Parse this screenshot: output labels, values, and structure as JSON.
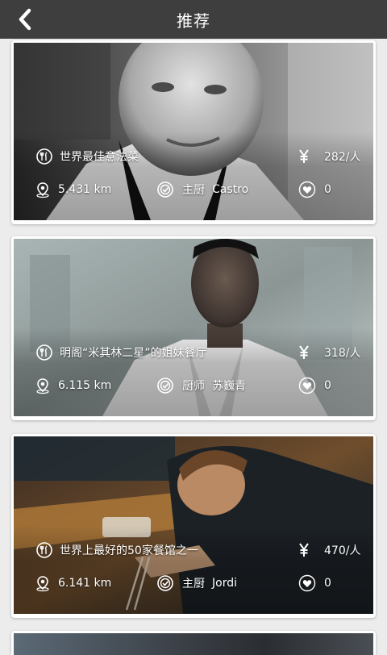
{
  "header": {
    "title": "推荐"
  },
  "restaurants": [
    {
      "description": "世界最佳意法菜",
      "price": "282/人",
      "distance": "5.431 km",
      "chef_title": "主厨",
      "chef_name": "Castro",
      "likes": "0"
    },
    {
      "description": "明阁“米其林二星”的姐妹餐厅",
      "price": "318/人",
      "distance": "6.115 km",
      "chef_title": "厨师",
      "chef_name": "苏巍青",
      "likes": "0"
    },
    {
      "description": "世界上最好的50家餐馆之一",
      "price": "470/人",
      "distance": "6.141 km",
      "chef_title": "主厨",
      "chef_name": "Jordi",
      "likes": "0"
    }
  ],
  "icons": {
    "back": "chevron-left-icon",
    "dish": "fork-knife-icon",
    "price": "yen-icon",
    "location": "map-pin-icon",
    "chef": "chef-badge-icon",
    "like": "heart-icon"
  },
  "colors": {
    "header_bg": "#3e3e3e",
    "page_bg": "#ececec",
    "text_on_photo": "#ffffff"
  }
}
